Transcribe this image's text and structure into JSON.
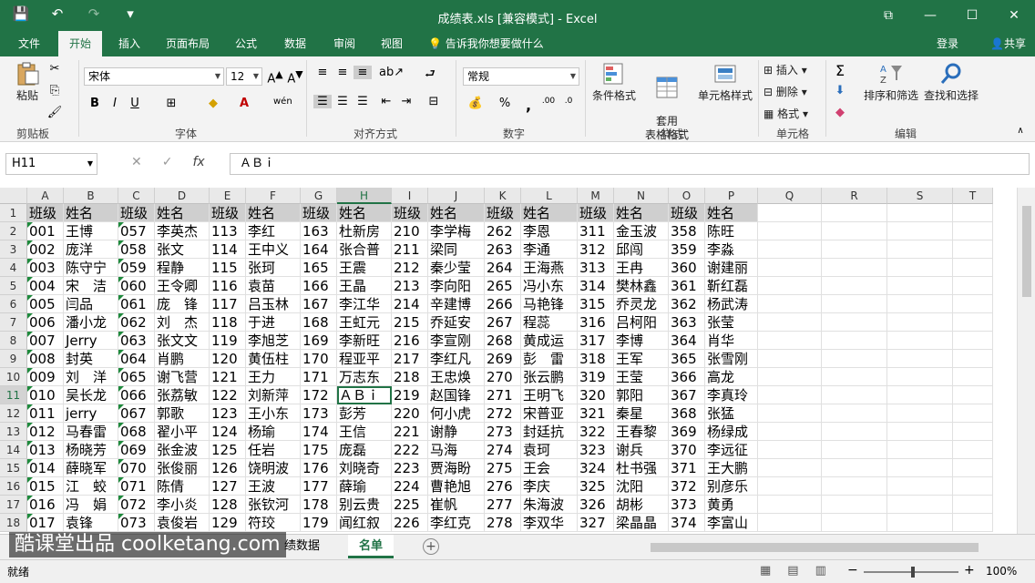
{
  "window": {
    "title": "成绩表.xls  [兼容模式]  -  Excel"
  },
  "qat": {
    "save": "💾",
    "undo": "↶",
    "redo": "↷",
    "more": "▾"
  },
  "tabs": [
    "文件",
    "开始",
    "插入",
    "页面布局",
    "公式",
    "数据",
    "审阅",
    "视图"
  ],
  "tellme": "告诉我你想要做什么",
  "account": {
    "login": "登录",
    "share": "共享"
  },
  "ribbon": {
    "paste": "粘贴",
    "clipboard": "剪贴板",
    "font_name": "宋体",
    "font_size": "12",
    "font_group": "字体",
    "align_group": "对齐方式",
    "number_format": "常规",
    "number_group": "数字",
    "cond_format": "条件格式",
    "table_format": "套用\n表格格式",
    "cell_style": "单元格样式",
    "style_group": "样式",
    "insert": "插入",
    "delete": "删除",
    "format": "格式",
    "cells_group": "单元格",
    "sort_filter": "排序和筛选",
    "find_select": "查找和选择",
    "edit_group": "编辑"
  },
  "formula": {
    "namebox": "H11",
    "cancel": "✕",
    "enter": "✓",
    "fx": "fx",
    "content": "ＡＢｉ"
  },
  "columns": [
    "A",
    "B",
    "C",
    "D",
    "E",
    "F",
    "G",
    "H",
    "I",
    "J",
    "K",
    "L",
    "M",
    "N",
    "O",
    "P",
    "Q",
    "R",
    "S",
    "T"
  ],
  "rows": [
    [
      "班级",
      "姓名",
      "班级",
      "姓名",
      "班级",
      "姓名",
      "班级",
      "姓名",
      "班级",
      "姓名",
      "班级",
      "姓名",
      "班级",
      "姓名",
      "班级",
      "姓名"
    ],
    [
      "001",
      "王博",
      "057",
      "李英杰",
      "113",
      "李红",
      "163",
      "杜新房",
      "210",
      "李学梅",
      "262",
      "李恩",
      "311",
      "金玉波",
      "358",
      "陈旺"
    ],
    [
      "002",
      "庞洋",
      "058",
      "张文",
      "114",
      "王中义",
      "164",
      "张合普",
      "211",
      "梁同",
      "263",
      "李通",
      "312",
      "邱闯",
      "359",
      "李淼"
    ],
    [
      "003",
      "陈守宁",
      "059",
      "程静",
      "115",
      "张珂",
      "165",
      "王震",
      "212",
      "秦少莹",
      "264",
      "王海燕",
      "313",
      "王冉",
      "360",
      "谢建丽"
    ],
    [
      "004",
      "宋　洁",
      "060",
      "王令卿",
      "116",
      "袁苗",
      "166",
      "王晶",
      "213",
      "李向阳",
      "265",
      "冯小东",
      "314",
      "樊林鑫",
      "361",
      "靳红磊"
    ],
    [
      "005",
      "闫品",
      "061",
      "庞　锋",
      "117",
      "吕玉林",
      "167",
      "李江华",
      "214",
      "辛建博",
      "266",
      "马艳锋",
      "315",
      "乔灵龙",
      "362",
      "杨武涛"
    ],
    [
      "006",
      "潘小龙",
      "062",
      "刘　杰",
      "118",
      "于进",
      "168",
      "王虹元",
      "215",
      "乔延安",
      "267",
      "程蕊",
      "316",
      "吕柯阳",
      "363",
      "张莹"
    ],
    [
      "007",
      "Jerry",
      "063",
      "张文文",
      "119",
      "李旭芝",
      "169",
      "李新旺",
      "216",
      "李宣刚",
      "268",
      "黄成运",
      "317",
      "李博",
      "364",
      "肖华"
    ],
    [
      "008",
      "封英",
      "064",
      "肖鹏",
      "120",
      "黄伍柱",
      "170",
      "程亚平",
      "217",
      "李红凡",
      "269",
      "彭　雷",
      "318",
      "王军",
      "365",
      "张雪刚"
    ],
    [
      "009",
      "刘　洋",
      "065",
      "谢飞营",
      "121",
      "王力",
      "171",
      "万志东",
      "218",
      "王忠焕",
      "270",
      "张云鹏",
      "319",
      "王莹",
      "366",
      "高龙"
    ],
    [
      "010",
      "吴长龙",
      "066",
      "张荔敏",
      "122",
      "刘新萍",
      "172",
      "ＡＢｉ",
      "219",
      "赵国锋",
      "271",
      "王明飞",
      "320",
      "郭阳",
      "367",
      "李真玲"
    ],
    [
      "011",
      "jerry",
      "067",
      "郭歌",
      "123",
      "王小东",
      "173",
      "彭芳",
      "220",
      "何小虎",
      "272",
      "宋普亚",
      "321",
      "秦星",
      "368",
      "张猛"
    ],
    [
      "012",
      "马春雷",
      "068",
      "翟小平",
      "124",
      "杨瑜",
      "174",
      "王信",
      "221",
      "谢静",
      "273",
      "封廷抗",
      "322",
      "王春黎",
      "369",
      "杨绿成"
    ],
    [
      "013",
      "杨晓芳",
      "069",
      "张金波",
      "125",
      "任岩",
      "175",
      "庞磊",
      "222",
      "马海",
      "274",
      "袁珂",
      "323",
      "谢兵",
      "370",
      "李远征"
    ],
    [
      "014",
      "薛晓军",
      "070",
      "张俊丽",
      "126",
      "饶明波",
      "176",
      "刘晓奇",
      "223",
      "贾海盼",
      "275",
      "王会",
      "324",
      "杜书强",
      "371",
      "王大鹏"
    ],
    [
      "015",
      "江　蛟",
      "071",
      "陈倩",
      "127",
      "王波",
      "177",
      "薛瑜",
      "224",
      "曹艳旭",
      "276",
      "李庆",
      "325",
      "沈阳",
      "372",
      "别彦乐"
    ],
    [
      "016",
      "冯　娟",
      "072",
      "李小炎",
      "128",
      "张钦河",
      "178",
      "别云贵",
      "225",
      "崔帆",
      "277",
      "朱海波",
      "326",
      "胡彬",
      "373",
      "黄勇"
    ],
    [
      "017",
      "袁锋",
      "073",
      "袁俊岩",
      "129",
      "符珓",
      "179",
      "闻红叙",
      "226",
      "李红克",
      "278",
      "李双华",
      "327",
      "梁晶晶",
      "374",
      "李富山"
    ]
  ],
  "sheets": {
    "prev": "绩数据",
    "active": "名单"
  },
  "watermark": "酷课堂出品 coolketang.com",
  "status": {
    "ready": "就绪",
    "zoom": "100%"
  }
}
